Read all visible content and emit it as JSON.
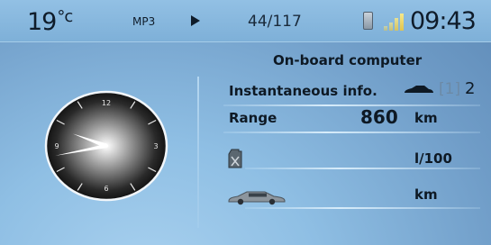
{
  "status_bar": {
    "temperature": "19",
    "temperature_unit": "°c",
    "source": "MP3",
    "play_icon": "play-icon",
    "track_counter": "44/117",
    "phone_icon": "phone-icon",
    "signal_icon": "signal-icon",
    "time": "09:43"
  },
  "panel": {
    "title": "On-board computer",
    "instantaneous_label": "Instantaneous info.",
    "trip_selector_bracket": "[1]",
    "trip_selector_other": "2",
    "range_label": "Range",
    "range_value": "860",
    "range_unit": "km",
    "consumption_unit": "l/100",
    "speed_unit": "km",
    "fuel_icon": "fuel-can-icon",
    "car_icon": "car-icon"
  },
  "analog_clock": {
    "numerals": [
      "12",
      "3",
      "6",
      "9"
    ],
    "hour_hand_angle": 292,
    "minute_hand_angle": 258
  },
  "colors": {
    "background": "#7fb0d9",
    "text": "#0e1924",
    "accent_signal": "#f0d860"
  }
}
